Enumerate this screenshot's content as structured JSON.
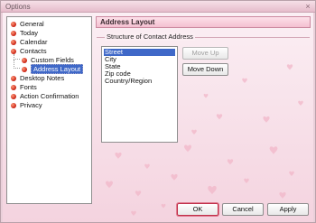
{
  "window": {
    "title": "Options",
    "close_glyph": "×"
  },
  "tree": {
    "items": [
      {
        "label": "General"
      },
      {
        "label": "Today"
      },
      {
        "label": "Calendar"
      },
      {
        "label": "Contacts"
      },
      {
        "label": "Custom Fields"
      },
      {
        "label": "Address Layout",
        "selected": true
      },
      {
        "label": "Desktop Notes"
      },
      {
        "label": "Fonts"
      },
      {
        "label": "Action Confirmation"
      },
      {
        "label": "Privacy"
      }
    ]
  },
  "panel": {
    "title": "Address Layout",
    "group_label": "Structure of Contact Address",
    "list": [
      "Street",
      "City",
      "State",
      "Zip code",
      "Country/Region"
    ],
    "selected_index": 0,
    "move_up_label": "Move Up",
    "move_down_label": "Move Down"
  },
  "footer": {
    "ok": "OK",
    "cancel": "Cancel",
    "apply": "Apply"
  },
  "colors": {
    "accent": "#3f68c8",
    "heart": "#f2b7c9",
    "bullet": "#c81e10"
  }
}
